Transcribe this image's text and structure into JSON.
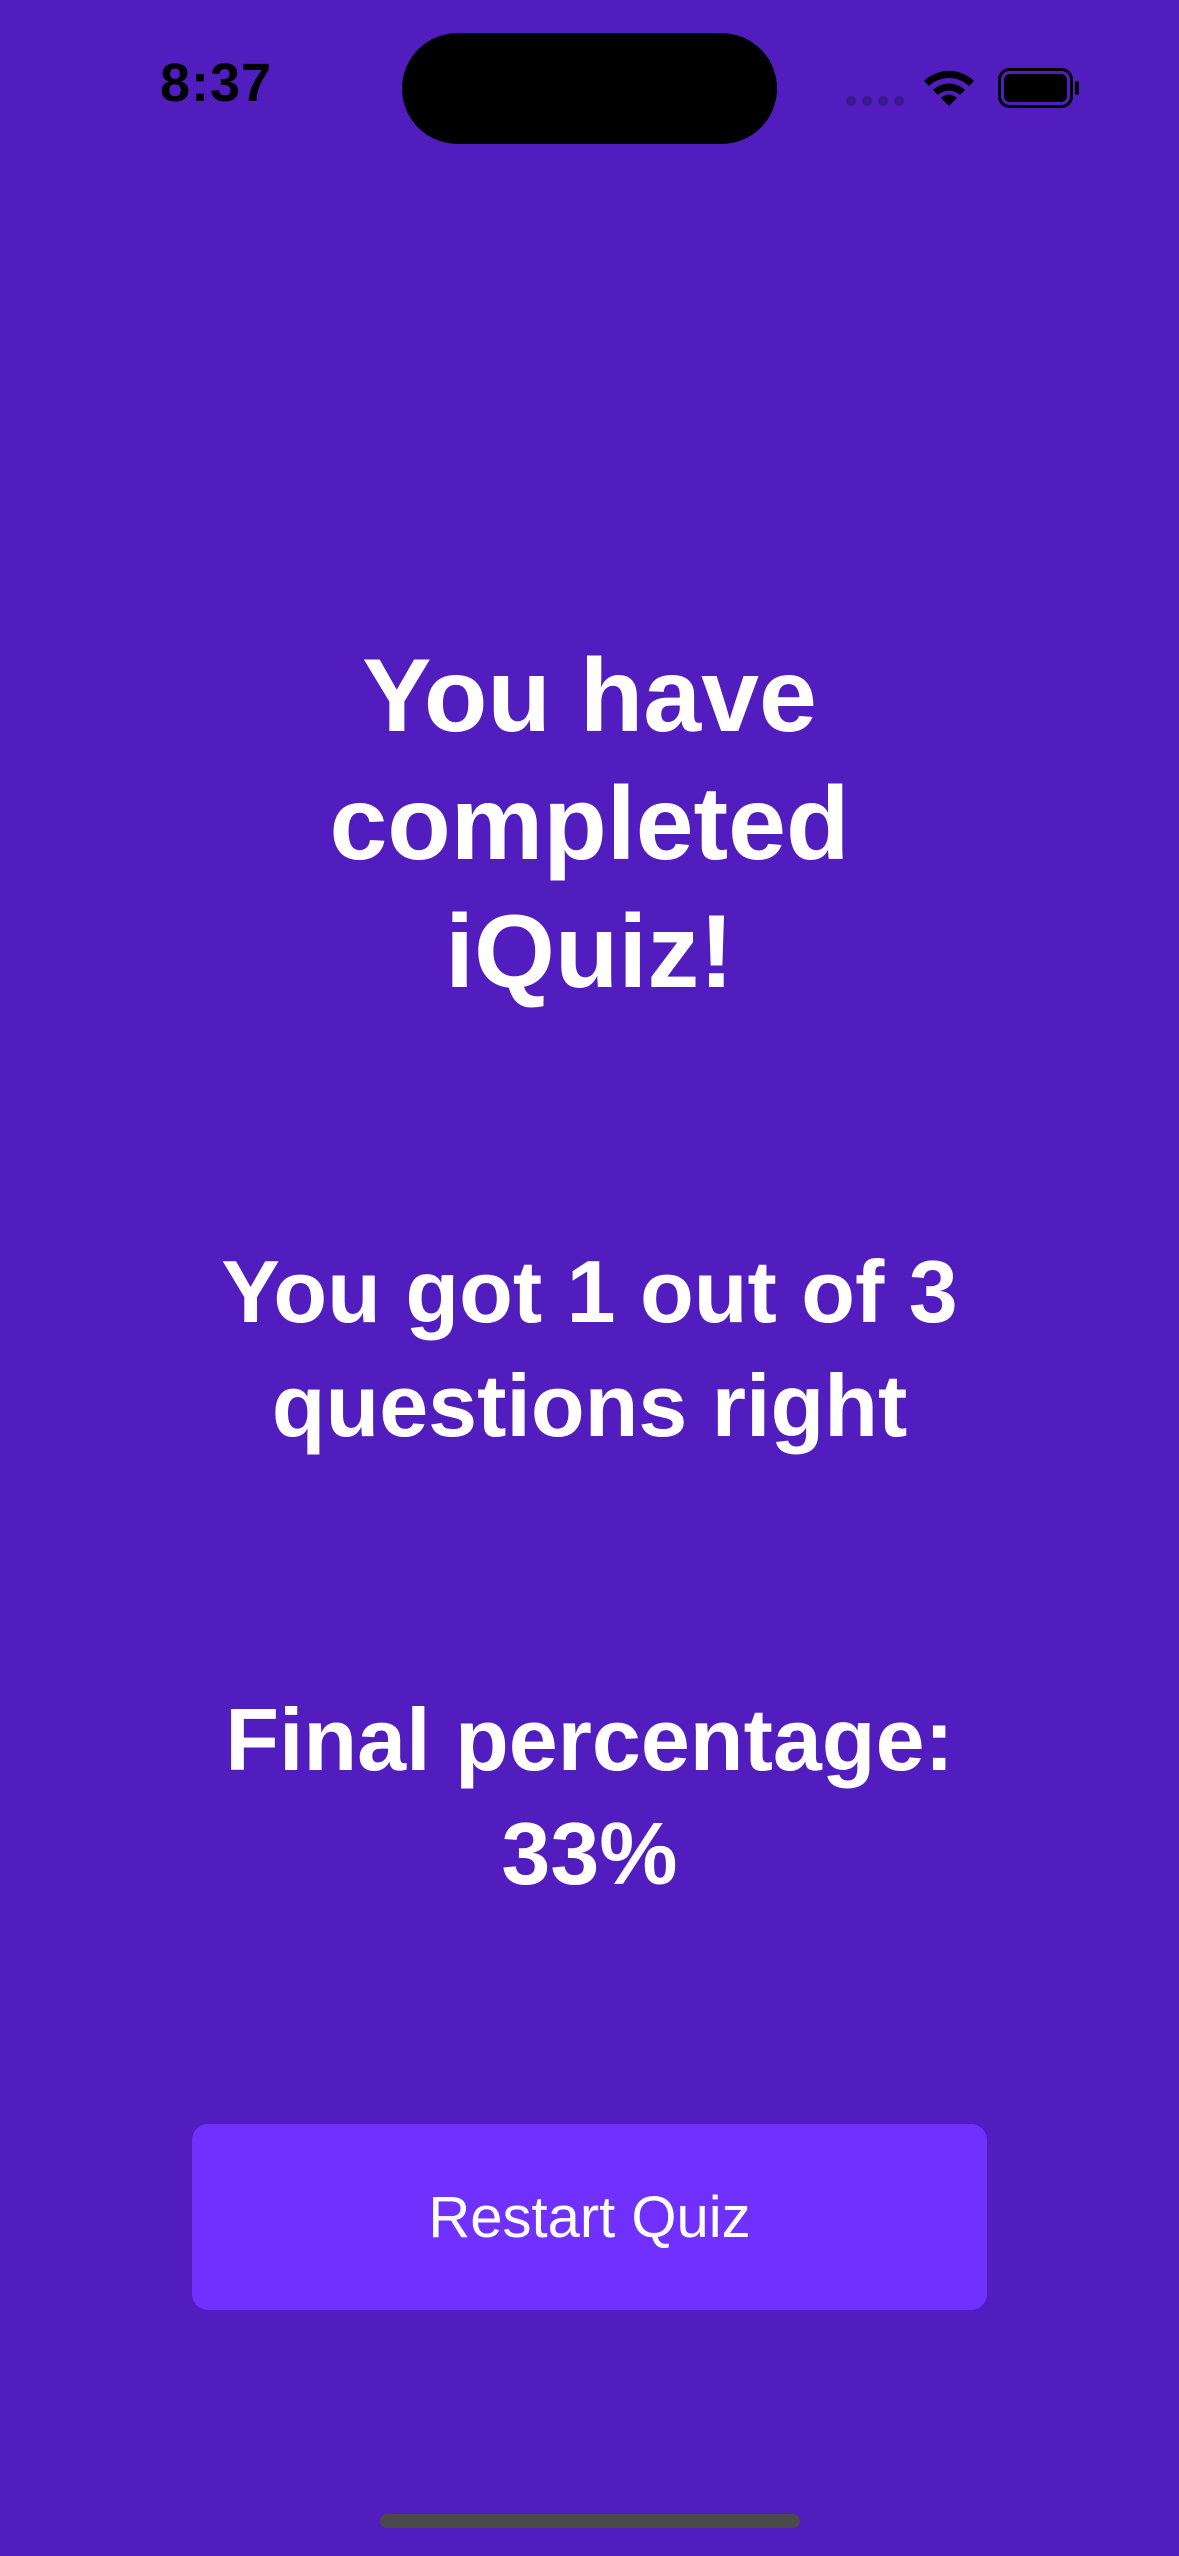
{
  "status_bar": {
    "time": "8:37"
  },
  "completion": {
    "line1": "You have",
    "line2": "completed",
    "line3": "iQuiz!"
  },
  "score": {
    "text": "You got 1 out of 3 questions right"
  },
  "percentage": {
    "label": "Final percentage:",
    "value": "33%"
  },
  "actions": {
    "restart_label": "Restart Quiz"
  },
  "colors": {
    "background": "#511dbf",
    "button": "#7031ff",
    "text": "#ffffff"
  }
}
